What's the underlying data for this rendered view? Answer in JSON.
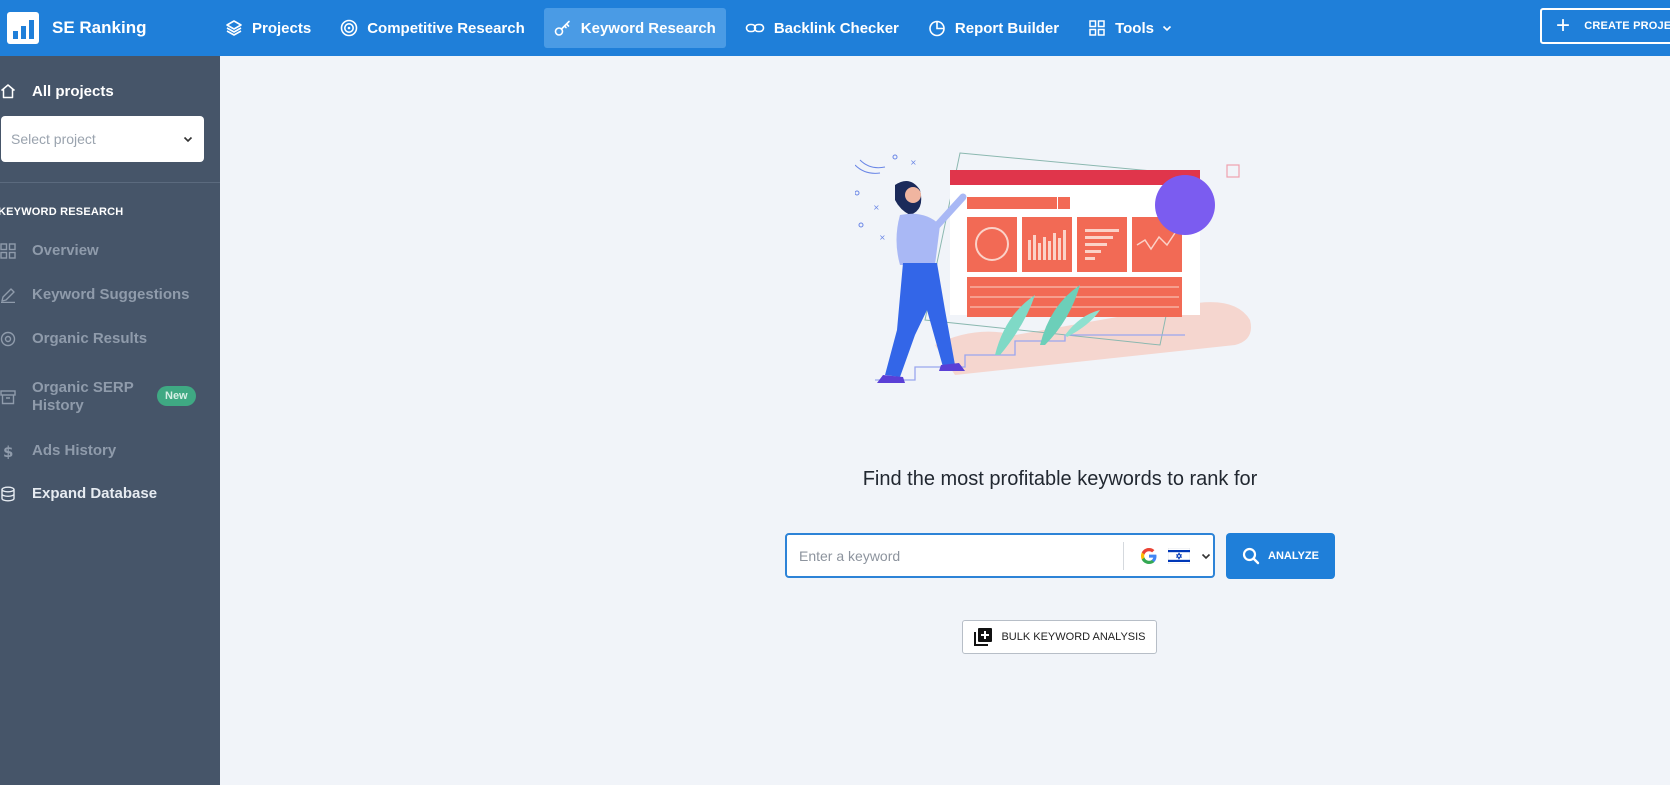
{
  "app": {
    "name": "SE Ranking"
  },
  "nav": {
    "projects": "Projects",
    "competitive": "Competitive Research",
    "keyword": "Keyword Research",
    "backlink": "Backlink Checker",
    "report": "Report Builder",
    "tools": "Tools",
    "create": "CREATE PROJEC"
  },
  "sidebar": {
    "all_projects": "All projects",
    "select_project": "Select project",
    "section_title": "KEYWORD RESEARCH",
    "items": [
      "Overview",
      "Keyword Suggestions",
      "Organic Results",
      "Organic SERP",
      "History",
      "Ads History",
      "Expand Database"
    ],
    "badge": "New"
  },
  "main": {
    "headline": "Find the most profitable keywords to rank for",
    "search_placeholder": "Enter a keyword",
    "analyze": "ANALYZE",
    "bulk": "BULK KEYWORD ANALYSIS"
  },
  "colors": {
    "primary": "#1f7fd9",
    "sidebar": "#465569",
    "background": "#f1f4f9",
    "badge": "#3fa983"
  },
  "icons": {
    "projects": "layers-icon",
    "competitive": "target-icon",
    "keyword": "key-icon",
    "backlink": "link-icon",
    "report": "pie-chart-icon",
    "tools": "grid-icon",
    "search": "magnifier-icon",
    "bulk": "add-stack-icon"
  }
}
